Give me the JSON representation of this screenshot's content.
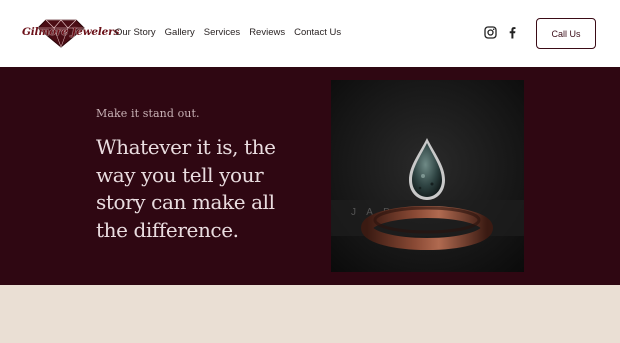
{
  "header": {
    "logo_text": "Gilmore Jewelers",
    "nav": [
      {
        "label": "Our Story"
      },
      {
        "label": "Gallery"
      },
      {
        "label": "Services"
      },
      {
        "label": "Reviews"
      },
      {
        "label": "Contact Us"
      }
    ],
    "social": [
      "instagram-icon",
      "facebook-icon"
    ],
    "cta_label": "Call Us"
  },
  "hero": {
    "eyebrow": "Make it stand out.",
    "headline": "Whatever it is, the way you tell your story can make all the difference."
  },
  "colors": {
    "hero_bg": "#2f0712",
    "band_bg": "#eadfd4",
    "accent": "#3a0b16",
    "logo_red": "#6b1018"
  }
}
